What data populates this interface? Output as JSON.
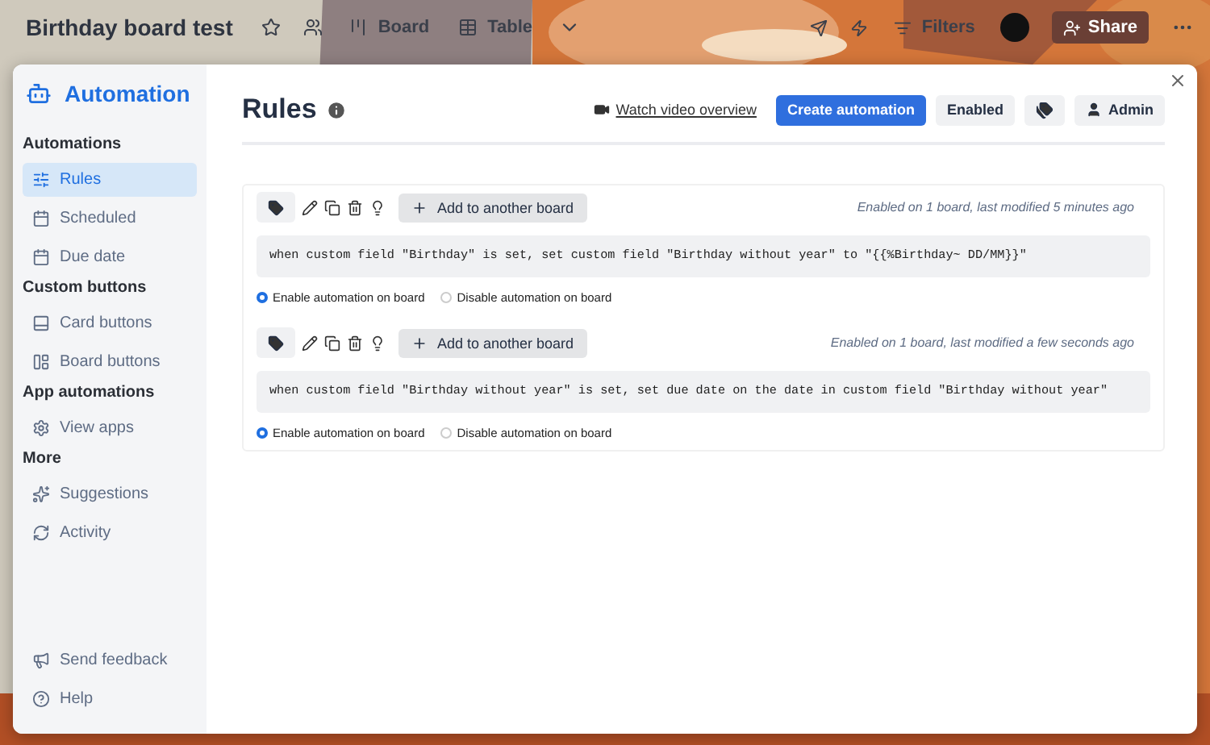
{
  "board": {
    "title": "Birthday board test",
    "views": [
      {
        "label": "Board",
        "kind": "board"
      },
      {
        "label": "Table",
        "kind": "table"
      }
    ],
    "filters": "Filters",
    "share": "Share"
  },
  "sidebar": {
    "title": "Automation",
    "sections": [
      {
        "heading": "Automations",
        "items": [
          {
            "label": "Rules",
            "kind": "rules",
            "selected": true
          },
          {
            "label": "Scheduled",
            "kind": "calendar",
            "selected": false
          },
          {
            "label": "Due date",
            "kind": "calendar",
            "selected": false
          }
        ]
      },
      {
        "heading": "Custom buttons",
        "items": [
          {
            "label": "Card buttons",
            "kind": "card",
            "selected": false
          },
          {
            "label": "Board buttons",
            "kind": "board",
            "selected": false
          }
        ]
      },
      {
        "heading": "App automations",
        "items": [
          {
            "label": "View apps",
            "kind": "gear",
            "selected": false
          }
        ]
      },
      {
        "heading": "More",
        "items": [
          {
            "label": "Suggestions",
            "kind": "sparkles",
            "selected": false
          },
          {
            "label": "Activity",
            "kind": "refresh",
            "selected": false
          }
        ]
      }
    ],
    "footer": [
      {
        "label": "Send feedback",
        "kind": "megaphone"
      },
      {
        "label": "Help",
        "kind": "help"
      }
    ]
  },
  "main": {
    "title": "Rules",
    "video_link": "Watch video overview",
    "create_button": "Create automation",
    "enabled_button": "Enabled",
    "admin_button": "Admin"
  },
  "rules": [
    {
      "add_button": "Add to another board",
      "status": "Enabled on 1 board, last modified 5 minutes ago",
      "code": "when custom field \"Birthday\" is set, set custom field \"Birthday without year\" to \"{{%Birthday~ DD/MM}}\"",
      "options": [
        {
          "label": "Enable automation on board",
          "selected": true
        },
        {
          "label": "Disable automation on board",
          "selected": false
        }
      ]
    },
    {
      "add_button": "Add to another board",
      "status": "Enabled on 1 board, last modified a few seconds ago",
      "code": "when custom field \"Birthday without year\" is set, set due date on the date in custom field \"Birthday without year\"",
      "options": [
        {
          "label": "Enable automation on board",
          "selected": true
        },
        {
          "label": "Disable automation on board",
          "selected": false
        }
      ]
    }
  ]
}
